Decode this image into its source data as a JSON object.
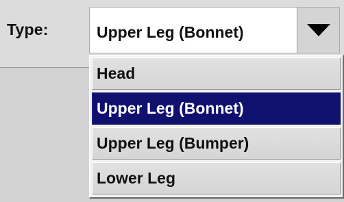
{
  "field": {
    "label": "Type:",
    "current_value": "Upper Leg (Bonnet)",
    "dropdown_icon": "triangle-down-icon"
  },
  "dropdown": {
    "options": [
      {
        "label": "Head",
        "selected": false
      },
      {
        "label": "Upper Leg (Bonnet)",
        "selected": true
      },
      {
        "label": "Upper Leg (Bumper)",
        "selected": false
      },
      {
        "label": "Lower Leg",
        "selected": false
      }
    ]
  },
  "colors": {
    "selection_background": "#10106f",
    "selection_text": "#ffffff"
  }
}
